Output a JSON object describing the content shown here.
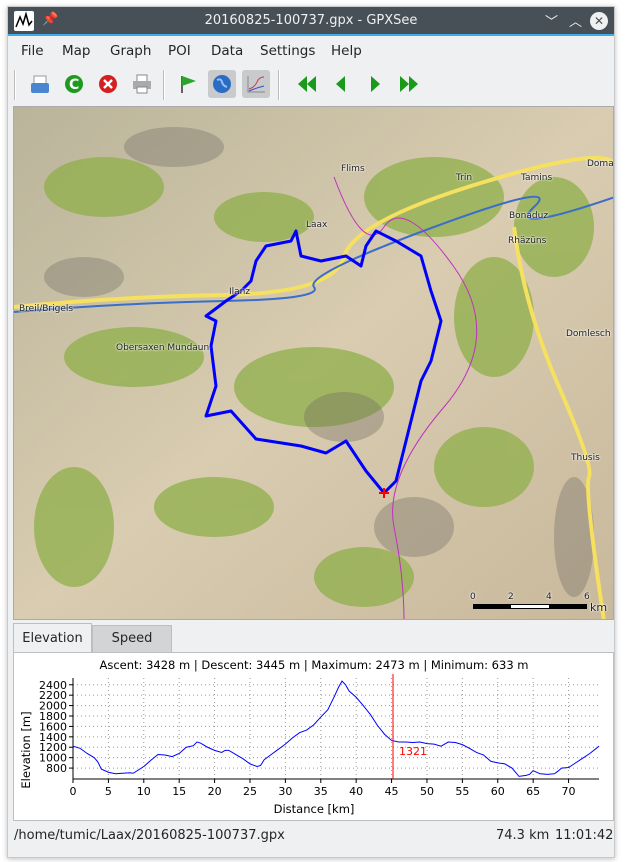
{
  "window": {
    "title": "20160825-100737.gpx - GPXSee"
  },
  "menu": [
    "File",
    "Map",
    "Graph",
    "POI",
    "Data",
    "Settings",
    "Help"
  ],
  "toolbar": {
    "icons": [
      "open-icon",
      "reload-icon",
      "close-file-icon",
      "print-icon",
      "poi-flag-icon",
      "map-globe-icon",
      "graph-icon",
      "first-icon",
      "previous-icon",
      "next-icon",
      "last-icon"
    ],
    "toggled": [
      "map-globe-icon",
      "graph-icon"
    ]
  },
  "map": {
    "places": [
      "Flims",
      "Trin",
      "Tamins",
      "Domat",
      "Laax",
      "Bonaduz",
      "Rhäzüns",
      "Ilanz",
      "Breil/Brigels",
      "Obersaxen Mundaun",
      "Domlesch",
      "Thusis"
    ],
    "scale": {
      "ticks": [
        "0",
        "2",
        "4",
        "6"
      ],
      "unit": "km"
    },
    "track_color": "#0000ff",
    "marker_color": "#ff0000"
  },
  "tabs": [
    {
      "label": "Elevation",
      "selected": true
    },
    {
      "label": "Speed",
      "selected": false
    }
  ],
  "graph": {
    "info": "Ascent: 3428 m | Descent: 3445 m | Maximum: 2473 m | Minimum: 633 m",
    "slider_label": "1321",
    "slider_x": 45.2
  },
  "chart_data": {
    "type": "line",
    "xlabel": "Distance [km]",
    "ylabel": "Elevation [m]",
    "xlim": [
      0,
      74.3
    ],
    "ylim": [
      590,
      2530
    ],
    "xticks": [
      0,
      5,
      10,
      15,
      20,
      25,
      30,
      35,
      40,
      45,
      50,
      55,
      60,
      65,
      70
    ],
    "yticks": [
      800,
      1000,
      1200,
      1400,
      1600,
      1800,
      2000,
      2200,
      2400
    ],
    "grid": true,
    "line_color": "#0000ff",
    "x": [
      0,
      1,
      2,
      3,
      3.5,
      4,
      5,
      6,
      7,
      8,
      8.5,
      10,
      11,
      12,
      13,
      14,
      15,
      16,
      17,
      17.5,
      18,
      19,
      20,
      21,
      21.5,
      22,
      23,
      24,
      25,
      26,
      26.5,
      27,
      28,
      29,
      30,
      31,
      32,
      33,
      34,
      35,
      36,
      37,
      37.5,
      38,
      38.5,
      39,
      40,
      41,
      42,
      43,
      44,
      45,
      46,
      47,
      48,
      49,
      50,
      51,
      52,
      53,
      54,
      55,
      56,
      57,
      58,
      59,
      60,
      61,
      62,
      63,
      64,
      64.5,
      65,
      66,
      67,
      68,
      68.5,
      69,
      70,
      71,
      72,
      73,
      74.3
    ],
    "y": [
      1220,
      1180,
      1080,
      1000,
      920,
      780,
      720,
      690,
      700,
      710,
      700,
      830,
      950,
      1060,
      1050,
      1020,
      1080,
      1200,
      1230,
      1300,
      1280,
      1200,
      1140,
      1100,
      1140,
      1140,
      1060,
      980,
      880,
      830,
      850,
      960,
      1060,
      1160,
      1260,
      1380,
      1480,
      1530,
      1630,
      1780,
      1920,
      2200,
      2350,
      2470,
      2400,
      2280,
      2160,
      2000,
      1830,
      1620,
      1450,
      1330,
      1300,
      1300,
      1290,
      1300,
      1270,
      1260,
      1220,
      1300,
      1290,
      1250,
      1180,
      1100,
      1050,
      930,
      900,
      880,
      800,
      640,
      660,
      680,
      750,
      690,
      680,
      690,
      740,
      800,
      810,
      900,
      990,
      1080,
      1220
    ]
  },
  "status": {
    "path": "/home/tumic/Laax/20160825-100737.gpx",
    "distance": "74.3 km",
    "time": "11:01:42"
  }
}
